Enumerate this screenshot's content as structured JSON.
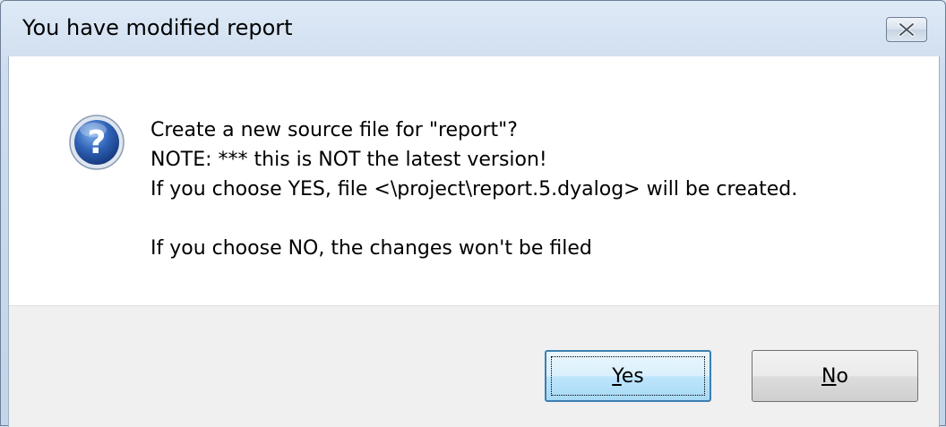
{
  "window": {
    "title": "You have modified report"
  },
  "icons": {
    "close": "close-icon",
    "question": "question-icon"
  },
  "message": {
    "line1": "Create a new source file for \"report\"?",
    "line2": "NOTE: *** this is NOT the latest version!",
    "line3": "If you choose YES, file <\\project\\report.5.dyalog> will be created.",
    "line4": "If you choose NO, the changes won't be filed"
  },
  "buttons": {
    "yes": {
      "mnemonic": "Y",
      "rest": "es"
    },
    "no": {
      "mnemonic": "N",
      "rest": "o"
    }
  },
  "colors": {
    "accent": "#3c7fb1",
    "icon_blue": "#2c5aa0"
  }
}
